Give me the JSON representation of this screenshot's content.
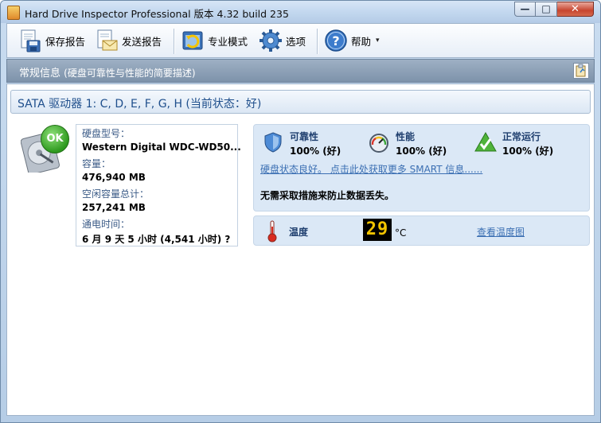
{
  "window": {
    "title": "Hard Drive Inspector Professional 版本 4.32 build 235",
    "min_glyph": "—",
    "max_glyph": "□",
    "close_glyph": "✕"
  },
  "toolbar": {
    "items": [
      {
        "label": "保存报告",
        "icon": "save-report-icon"
      },
      {
        "label": "发送报告",
        "icon": "send-report-icon"
      },
      {
        "label": "专业模式",
        "icon": "expert-mode-icon"
      },
      {
        "label": "选项",
        "icon": "gear-icon"
      },
      {
        "label": "帮助",
        "icon": "help-icon"
      }
    ],
    "help_caret": "▾"
  },
  "section": {
    "title": "常规信息",
    "subtitle": "(硬盘可靠性与性能的简要描述)"
  },
  "drive": {
    "title": "SATA 驱动器 1: C, D, E, F, G, H (当前状态：好)",
    "status_badge": "OK",
    "model_label": "硬盘型号：",
    "model_value": "Western Digital WDC-WD50...",
    "capacity_label": "容量：",
    "capacity_value": "476,940 MB",
    "free_label": "空闲容量总计：",
    "free_value": "257,241 MB",
    "power_label": "通电时间：",
    "power_value": "6 月 9 天 5 小时 (4,541 小时) ?"
  },
  "status": {
    "reliability_label": "可靠性",
    "reliability_value": "100% (好)",
    "performance_label": "性能",
    "performance_value": "100% (好)",
    "uptime_label": "正常运行",
    "uptime_value": "100% (好)",
    "smart_link": "硬盘状态良好。 点击此处获取更多 SMART 信息......",
    "note": "无需采取措施来防止数据丢失。"
  },
  "temperature": {
    "label": "温度",
    "value": "29",
    "unit": "°C",
    "chart_link": "查看温度图"
  },
  "colors": {
    "accent": "#1f4f8c",
    "link": "#3b6fb3",
    "ok_green": "#2e9a1f",
    "temp_digits": "#f2c400"
  }
}
